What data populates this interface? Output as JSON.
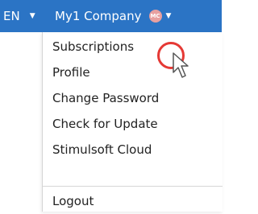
{
  "header": {
    "language": "EN",
    "company_name": "My1 Company",
    "avatar_initials": "MC",
    "bar_color": "#2b74c5"
  },
  "menu": {
    "items": [
      {
        "label": "Subscriptions"
      },
      {
        "label": "Profile"
      },
      {
        "label": "Change Password"
      },
      {
        "label": "Check for Update"
      },
      {
        "label": "Stimulsoft Cloud"
      },
      {
        "label": "Logout"
      }
    ]
  },
  "annotation": {
    "highlight_color": "#e53935",
    "cursor_icon": "arrow-pointer-icon"
  }
}
